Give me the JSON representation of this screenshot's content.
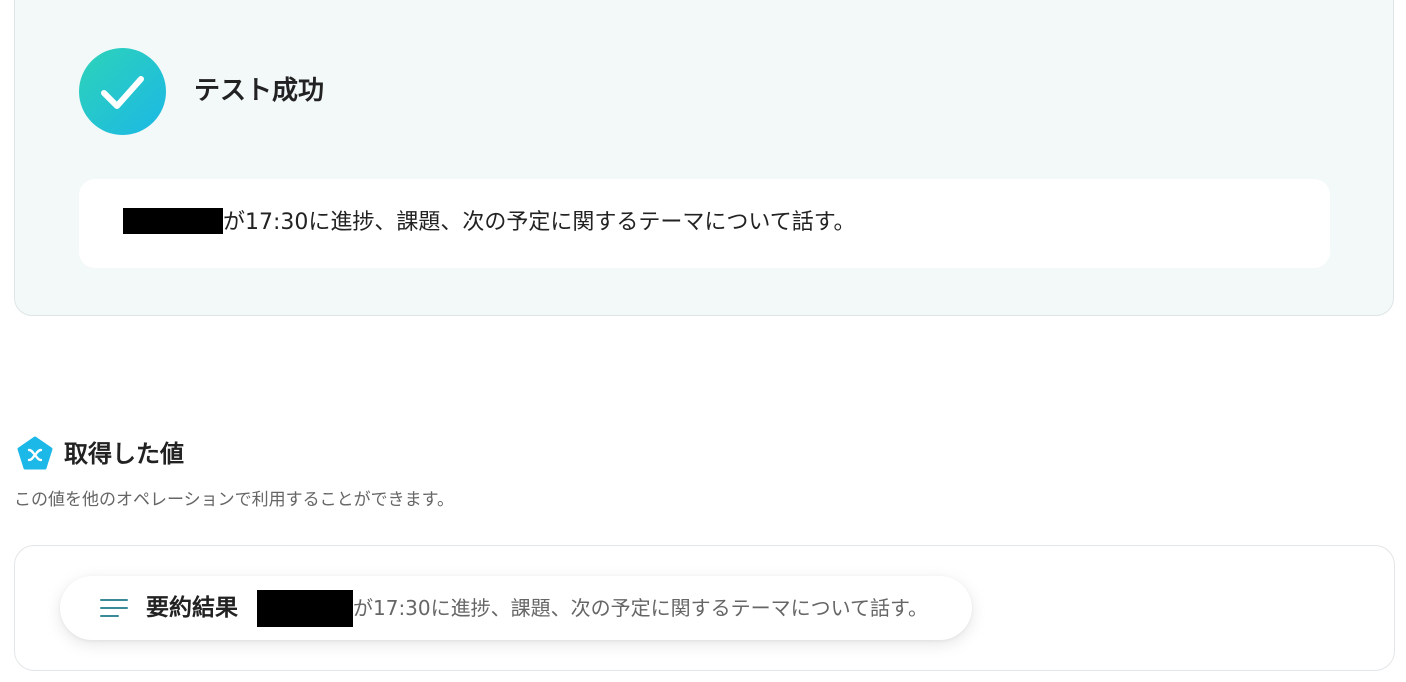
{
  "test_result": {
    "status_icon": "check-circle-icon",
    "title": "テスト成功",
    "message": "が17:30に進捗、課題、次の予定に関するテーマについて話す。"
  },
  "obtained_values": {
    "icon": "yoom-pentagon-icon",
    "title": "取得した値",
    "description": "この値を他のオペレーションで利用することができます。",
    "items": [
      {
        "icon": "lines-icon",
        "label": "要約結果",
        "value": "が17:30に進捗、課題、次の予定に関するテーマについて話す。"
      }
    ]
  },
  "colors": {
    "accent_gradient_start": "#2ed3b8",
    "accent_gradient_end": "#1bb8e6",
    "card_background": "#f3f8f8"
  }
}
